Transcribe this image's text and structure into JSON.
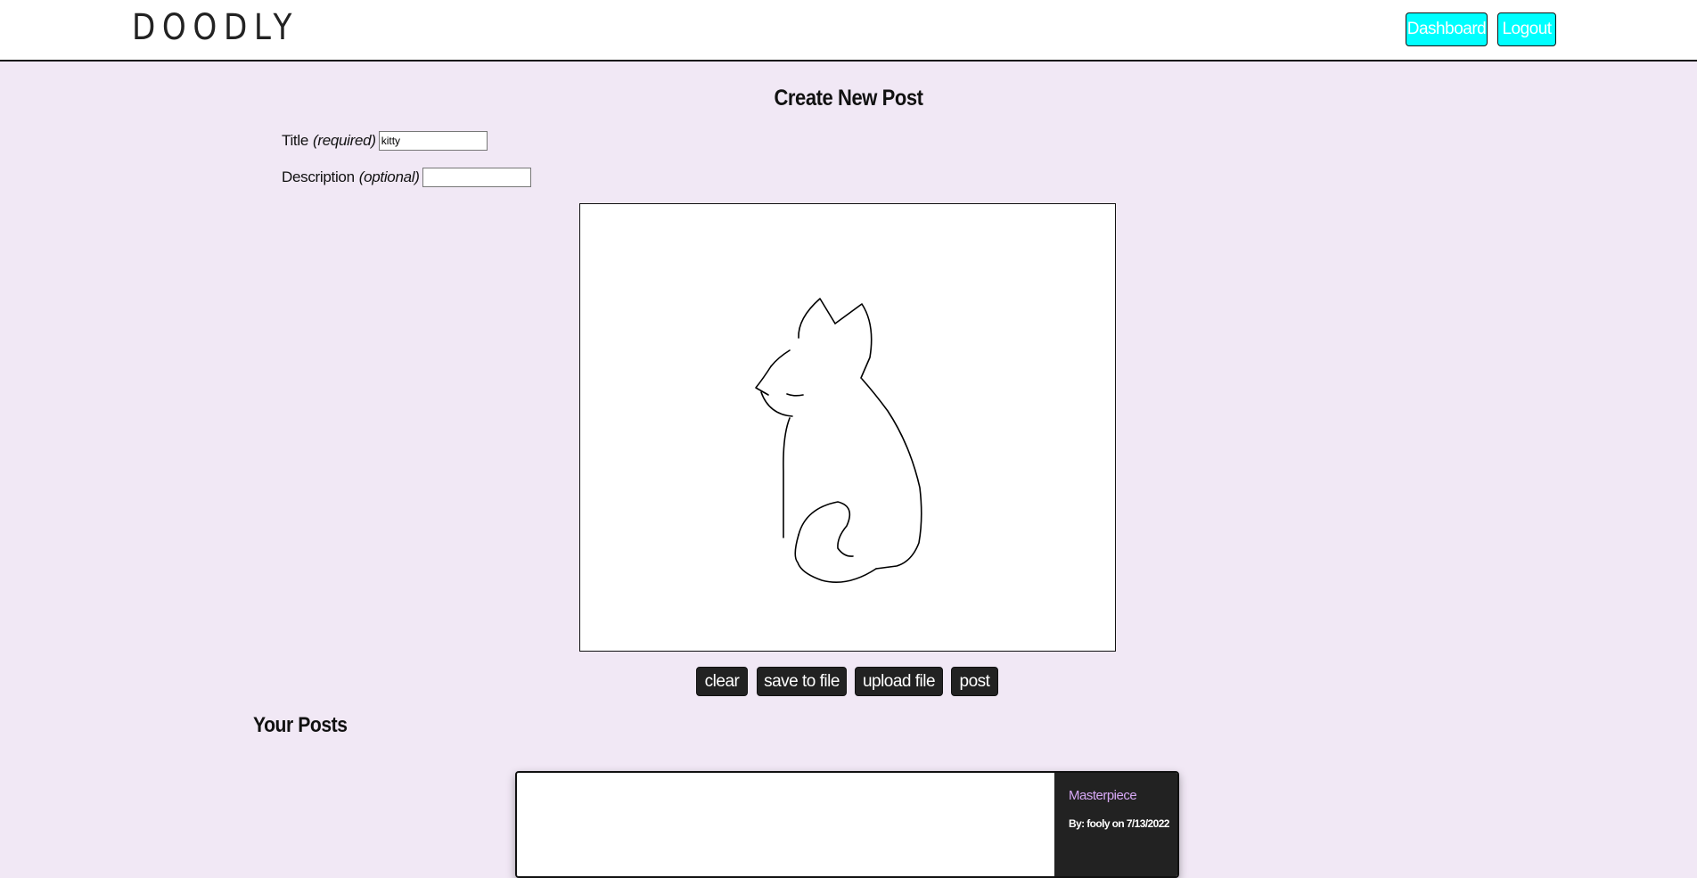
{
  "header": {
    "logo": "DOODLY",
    "nav": {
      "dashboard_label": "Dashboard",
      "logout_label": "Logout"
    },
    "colors": {
      "nav_button_bg": "#00ffff",
      "background": "#f1e8f5"
    }
  },
  "create_post": {
    "heading": "Create New Post",
    "title_field": {
      "label": "Title",
      "hint": "(required)",
      "value": "kitty"
    },
    "description_field": {
      "label": "Description",
      "hint": "(optional)",
      "value": ""
    },
    "canvas": {
      "drawing": "cat outline sketch"
    },
    "buttons": {
      "clear": "clear",
      "save": "save to file",
      "upload": "upload file",
      "post": "post"
    }
  },
  "your_posts": {
    "heading": "Your Posts",
    "items": [
      {
        "title": "Masterpiece",
        "meta": "By: fooly on 7/13/2022"
      }
    ],
    "colors": {
      "title_color": "#d7a8f5",
      "info_bg": "#222222"
    }
  }
}
